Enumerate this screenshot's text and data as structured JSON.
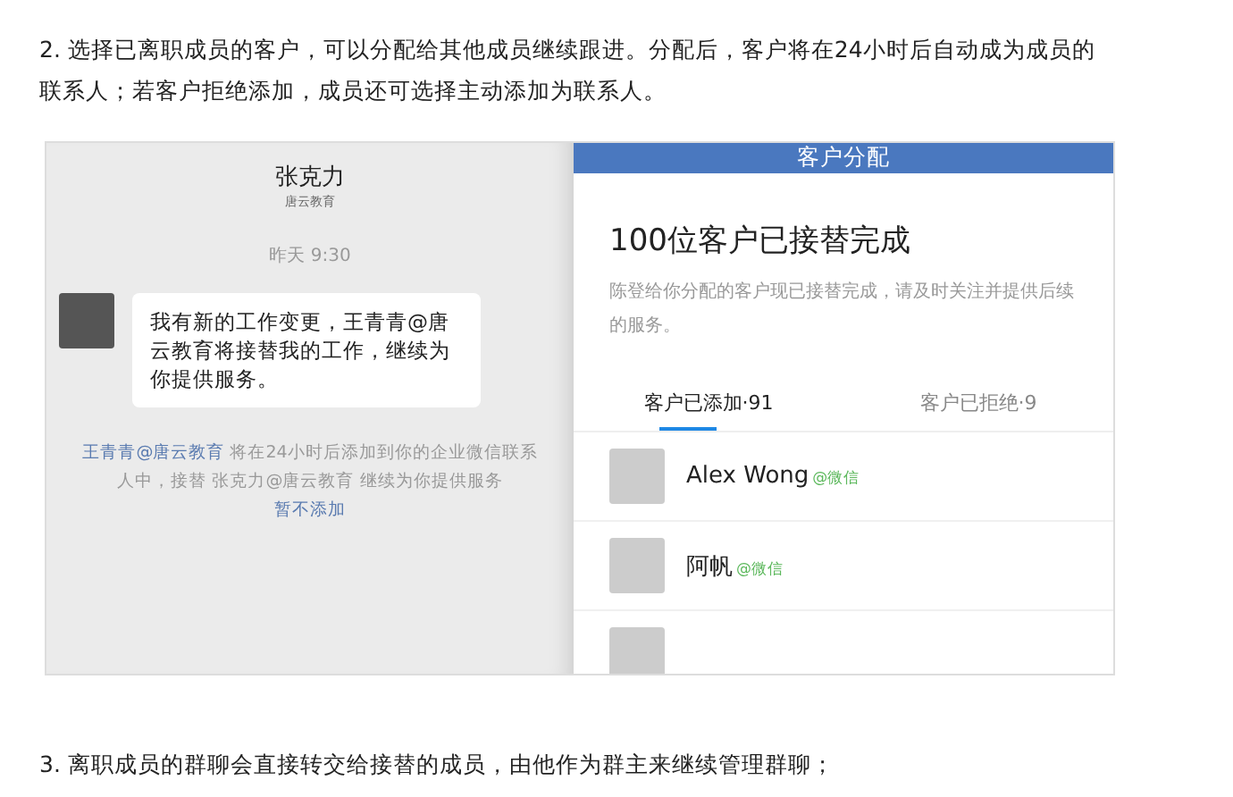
{
  "paragraphs": [
    {
      "text": "2. 选择已离职成员的客户，可以分配给其他成员继续跟进。分配后，客户将在24小时后自动成为成员的联系人；若客户拒绝添加，成员还可选择主动添加为联系人。"
    }
  ],
  "chat": {
    "name": "张克力",
    "company": "唐云教育",
    "time": "昨天 9:30",
    "message": "我有新的工作变更，王青青@唐云教育将接替我的工作，继续为你提供服务。",
    "notice": {
      "link": "王青青@唐云教育",
      "middle": "将在24小时后添加到你的企业微信联系人中，接替 张克力@唐云教育 继续为你提供服务",
      "action": "暂不添加"
    }
  },
  "assign": {
    "header": "客户分配",
    "title": "100位客户已接替完成",
    "desc": "陈登给你分配的客户现已接替完成，请及时关注并提供后续的服务。",
    "tabs": [
      {
        "label": "客户已添加·91",
        "selected": true
      },
      {
        "label": "客户已拒绝·9",
        "selected": false
      }
    ],
    "customers": [
      {
        "kind": "contact",
        "name": "Alex Wong",
        "source": "@微信"
      },
      {
        "kind": "contact",
        "name": "阿帆",
        "source": "@微信"
      },
      {
        "kind": "cut"
      }
    ]
  },
  "footer": {
    "text": "3. 离职成员的群聊会直接转交给接替的成员，由他作为群主来继续管理群聊；"
  }
}
